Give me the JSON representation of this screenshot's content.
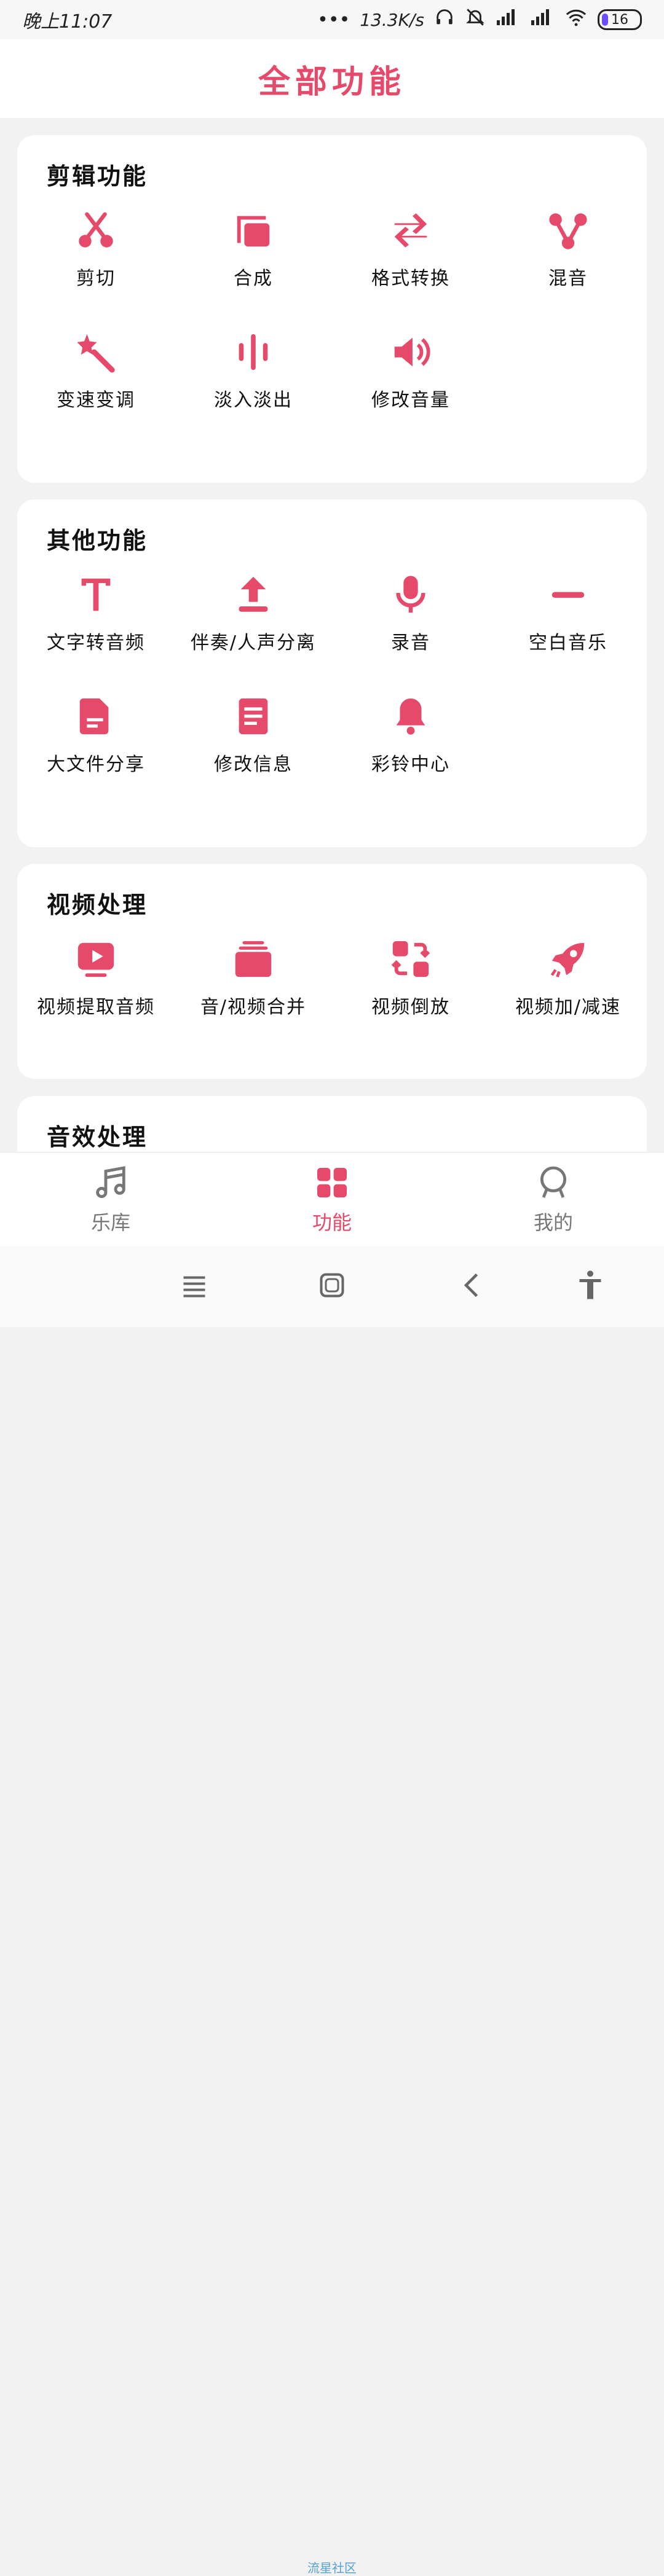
{
  "status_bar": {
    "time": "晚上11:07",
    "net_speed": "13.3K/s",
    "battery": "16"
  },
  "header": {
    "title": "全部功能"
  },
  "sections": [
    {
      "title": "剪辑功能",
      "items": [
        {
          "label": "剪切",
          "icon": "scissors-icon"
        },
        {
          "label": "合成",
          "icon": "copy-icon"
        },
        {
          "label": "格式转换",
          "icon": "swap-icon"
        },
        {
          "label": "混音",
          "icon": "mix-icon"
        },
        {
          "label": "变速变调",
          "icon": "magic-wand-icon"
        },
        {
          "label": "淡入淡出",
          "icon": "audio-bars-icon"
        },
        {
          "label": "修改音量",
          "icon": "volume-icon"
        }
      ]
    },
    {
      "title": "其他功能",
      "items": [
        {
          "label": "文字转音频",
          "icon": "text-icon"
        },
        {
          "label": "伴奏/人声分离",
          "icon": "upload-icon"
        },
        {
          "label": "录音",
          "icon": "microphone-icon"
        },
        {
          "label": "空白音乐",
          "icon": "minus-icon"
        },
        {
          "label": "大文件分享",
          "icon": "file-icon"
        },
        {
          "label": "修改信息",
          "icon": "document-icon"
        },
        {
          "label": "彩铃中心",
          "icon": "bell-icon"
        }
      ]
    },
    {
      "title": "视频处理",
      "items": [
        {
          "label": "视频提取音频",
          "icon": "video-play-icon"
        },
        {
          "label": "音/视频合并",
          "icon": "stack-icon"
        },
        {
          "label": "视频倒放",
          "icon": "reverse-icon"
        },
        {
          "label": "视频加/减速",
          "icon": "rocket-icon"
        }
      ]
    },
    {
      "title": "音效处理",
      "items": []
    }
  ],
  "bottom_nav": [
    {
      "label": "乐库",
      "icon": "music-note-icon",
      "active": false
    },
    {
      "label": "功能",
      "icon": "grid-icon",
      "active": true
    },
    {
      "label": "我的",
      "icon": "profile-icon",
      "active": false
    }
  ],
  "watermark": "流星社区",
  "colors": {
    "accent": "#e64a6b",
    "inactive": "#777777"
  }
}
